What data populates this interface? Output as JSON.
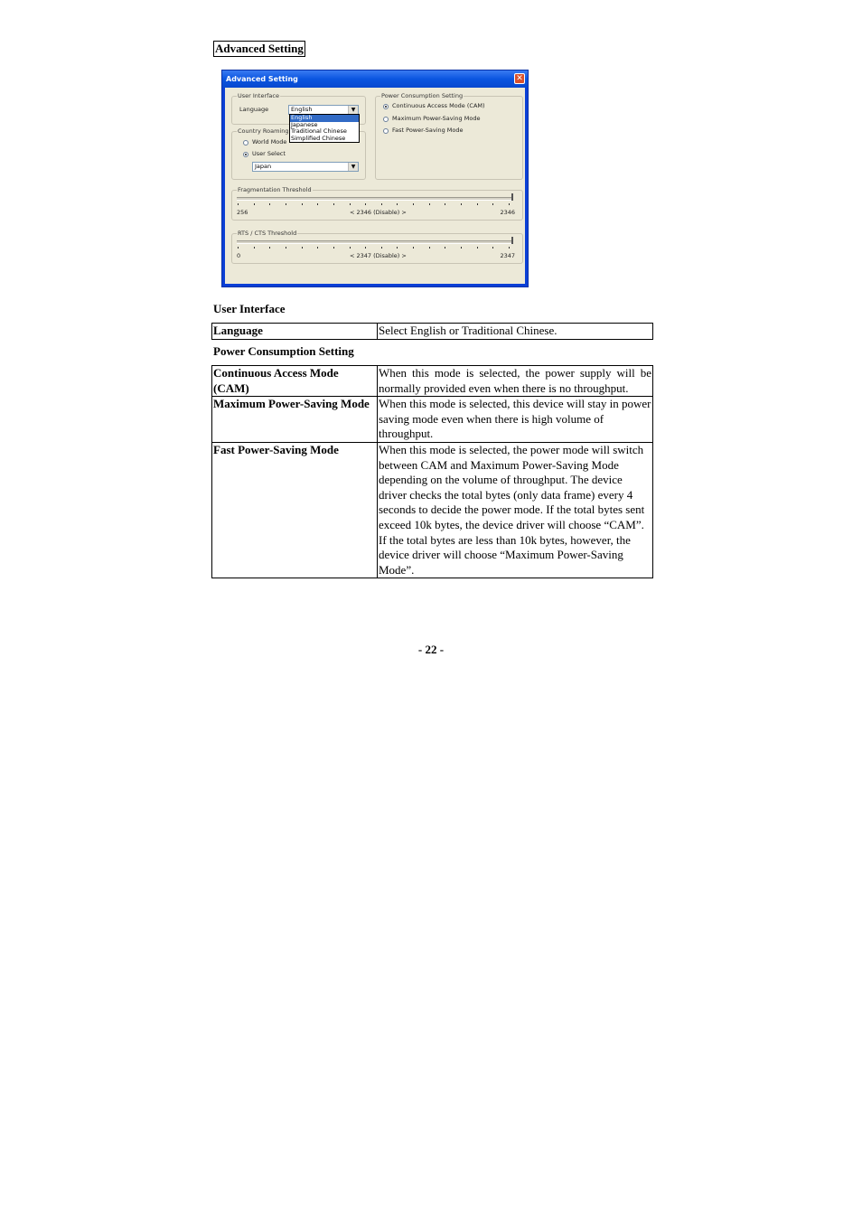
{
  "doc_heading": "Advanced Setting",
  "dialog": {
    "title": "Advanced Setting",
    "close_glyph": "✕",
    "user_interface": {
      "group_label": "User Interface",
      "language_label": "Language",
      "language_value": "English",
      "dropdown_arrow": "▼",
      "dropdown_options": [
        "English",
        "Japanese",
        "Traditional Chinese",
        "Simplified Chinese"
      ],
      "dropdown_selected": "English"
    },
    "country_roaming": {
      "group_label": "Country Roaming",
      "world_mode_label": "World Mode",
      "user_select_label": "User Select",
      "selected": "User Select",
      "country_value": "Japan"
    },
    "power_consumption": {
      "group_label": "Power Consumption Setting",
      "options": [
        "Continuous Access Mode (CAM)",
        "Maximum Power-Saving Mode",
        "Fast Power-Saving Mode"
      ],
      "selected": "Continuous Access Mode (CAM)"
    },
    "fragmentation": {
      "group_label": "Fragmentation Threshold",
      "min": "256",
      "max": "2346",
      "current": "< 2346 (Disable) >",
      "value_fraction": 1.0
    },
    "rts_cts": {
      "group_label": "RTS / CTS Threshold",
      "min": "0",
      "max": "2347",
      "current": "< 2347 (Disable) >",
      "value_fraction": 1.0
    }
  },
  "user_interface_section": {
    "title": "User Interface",
    "rows": [
      {
        "key": "Language",
        "value": "Select English or Traditional Chinese."
      }
    ]
  },
  "power_section": {
    "title": "Power Consumption Setting",
    "rows": [
      {
        "key": "Continuous Access Mode (CAM)",
        "value": "When this mode is selected, the power supply will be normally provided even when there is no throughput."
      },
      {
        "key": "Maximum Power-Saving Mode",
        "value": "When this mode is selected, this device will stay in power saving mode even when there is high volume of throughput."
      },
      {
        "key": "Fast Power-Saving Mode",
        "value": "When this mode is selected, the power mode will switch between CAM and Maximum Power-Saving Mode depending on the volume of throughput. The device driver checks the total bytes (only data frame) every 4 seconds to decide the power mode. If the total bytes sent exceed 10k bytes, the device driver will choose “CAM”. If the total bytes are less than 10k bytes, however, the device driver will choose “Maximum Power-Saving Mode”."
      }
    ]
  },
  "page_number": "- 22 -"
}
